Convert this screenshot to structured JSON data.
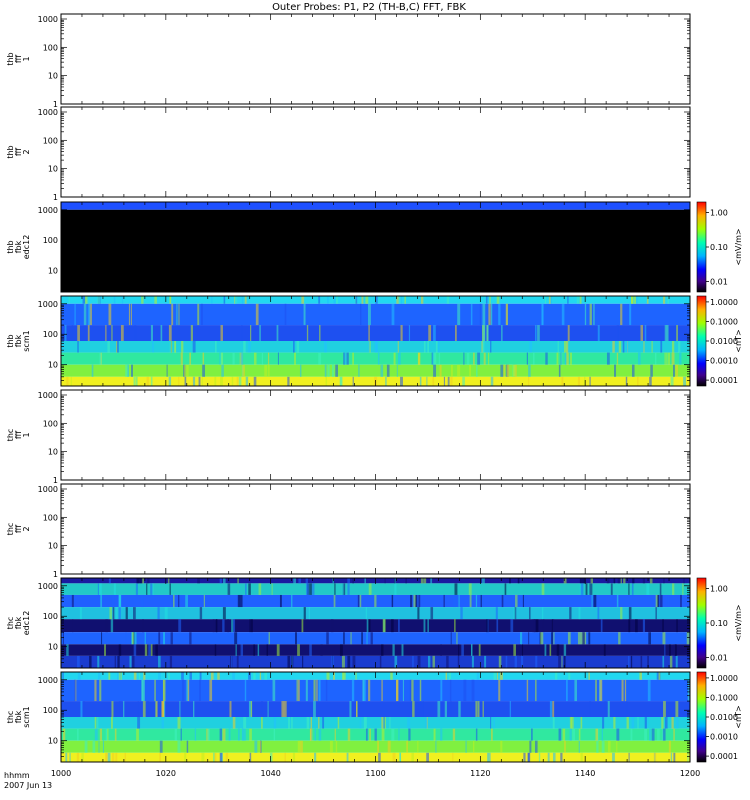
{
  "chart_data": {
    "type": "heatmap",
    "title": "Outer Probes: P1, P2 (TH-B,C) FFT, FBK",
    "time_axis": {
      "tick_labels": [
        "1000",
        "1020",
        "1040",
        "1100",
        "1120",
        "1140",
        "1200"
      ],
      "label_line1": "hhmm",
      "label_line2": "2007 Jun 13"
    },
    "yscale": "log",
    "grid": false,
    "panels": [
      {
        "id": "thb-fff1",
        "ylabel": [
          "thb",
          "fff",
          "1"
        ],
        "ylim": [
          1,
          1500
        ],
        "y_ticks": [
          "1000",
          "100",
          "10",
          "1"
        ],
        "content": "empty"
      },
      {
        "id": "thb-fff2",
        "ylabel": [
          "thb",
          "fff",
          "2"
        ],
        "ylim": [
          1,
          1500
        ],
        "y_ticks": [
          "1000",
          "100",
          "10",
          "1"
        ],
        "content": "empty"
      },
      {
        "id": "thb-fbk-edc12",
        "ylabel": [
          "thb",
          "fbk",
          "edc12"
        ],
        "ylim": [
          2,
          1800
        ],
        "y_ticks": [
          "1000",
          "100",
          "10"
        ],
        "content": "spectrogram",
        "pattern": "edc_b",
        "colorbar": {
          "label": "<mV/m>",
          "ticks": [
            "1.00",
            "0.10",
            "0.01"
          ],
          "range": [
            0.005,
            2.0
          ]
        }
      },
      {
        "id": "thb-fbk-scm1",
        "ylabel": [
          "thb",
          "fbk",
          "scm1"
        ],
        "ylim": [
          2,
          1800
        ],
        "y_ticks": [
          "1000",
          "100",
          "10"
        ],
        "content": "spectrogram",
        "pattern": "scm",
        "colorbar": {
          "label": "<nT>",
          "ticks": [
            "1.0000",
            "0.1000",
            "0.0100",
            "0.0010",
            "0.0001"
          ],
          "range": [
            5e-05,
            2.0
          ]
        }
      },
      {
        "id": "thc-fff1",
        "ylabel": [
          "thc",
          "fff",
          "1"
        ],
        "ylim": [
          1,
          1500
        ],
        "y_ticks": [
          "1000",
          "100",
          "10",
          "1"
        ],
        "content": "empty"
      },
      {
        "id": "thc-fff2",
        "ylabel": [
          "thc",
          "fff",
          "2"
        ],
        "ylim": [
          1,
          1500
        ],
        "y_ticks": [
          "1000",
          "100",
          "10",
          "1"
        ],
        "content": "empty"
      },
      {
        "id": "thc-fbk-edc12",
        "ylabel": [
          "thc",
          "fbk",
          "edc12"
        ],
        "ylim": [
          2,
          1800
        ],
        "y_ticks": [
          "1000",
          "100",
          "10"
        ],
        "content": "spectrogram",
        "pattern": "edc_c",
        "colorbar": {
          "label": "<mV/m>",
          "ticks": [
            "1.00",
            "0.10",
            "0.01"
          ],
          "range": [
            0.005,
            2.0
          ]
        }
      },
      {
        "id": "thc-fbk-scm1",
        "ylabel": [
          "thc",
          "fbk",
          "scm1"
        ],
        "ylim": [
          2,
          1800
        ],
        "y_ticks": [
          "1000",
          "100",
          "10"
        ],
        "content": "spectrogram",
        "pattern": "scm",
        "colorbar": {
          "label": "<nT>",
          "ticks": [
            "1.0000",
            "0.1000",
            "0.0100",
            "0.0010",
            "0.0001"
          ],
          "range": [
            5e-05,
            2.0
          ]
        }
      }
    ],
    "spectrogram_bands": {
      "edc_b": [
        {
          "f_lo": 1000,
          "f_hi": 1800,
          "color": "#1e50ff"
        },
        {
          "f_lo": 2,
          "f_hi": 1000,
          "color": "#000000"
        }
      ],
      "edc_c": [
        {
          "f_lo": 1200,
          "f_hi": 1800,
          "color": "#1a1aa0"
        },
        {
          "f_lo": 500,
          "f_hi": 1200,
          "color": "#22c8c8"
        },
        {
          "f_lo": 200,
          "f_hi": 500,
          "color": "#2060ff"
        },
        {
          "f_lo": 80,
          "f_hi": 200,
          "color": "#20c0e0"
        },
        {
          "f_lo": 30,
          "f_hi": 80,
          "color": "#101070"
        },
        {
          "f_lo": 12,
          "f_hi": 30,
          "color": "#1e64ff"
        },
        {
          "f_lo": 5,
          "f_hi": 12,
          "color": "#101070"
        },
        {
          "f_lo": 2,
          "f_hi": 5,
          "color": "#1a3cd0"
        }
      ],
      "scm": [
        {
          "f_lo": 1000,
          "f_hi": 1800,
          "color": "#22d8f0"
        },
        {
          "f_lo": 200,
          "f_hi": 1000,
          "color": "#1e64ff"
        },
        {
          "f_lo": 60,
          "f_hi": 200,
          "color": "#1e50f0"
        },
        {
          "f_lo": 25,
          "f_hi": 60,
          "color": "#20d0e0"
        },
        {
          "f_lo": 10,
          "f_hi": 25,
          "color": "#30e8a0"
        },
        {
          "f_lo": 4,
          "f_hi": 10,
          "color": "#80f040"
        },
        {
          "f_lo": 2,
          "f_hi": 4,
          "color": "#f0f020"
        }
      ]
    }
  }
}
